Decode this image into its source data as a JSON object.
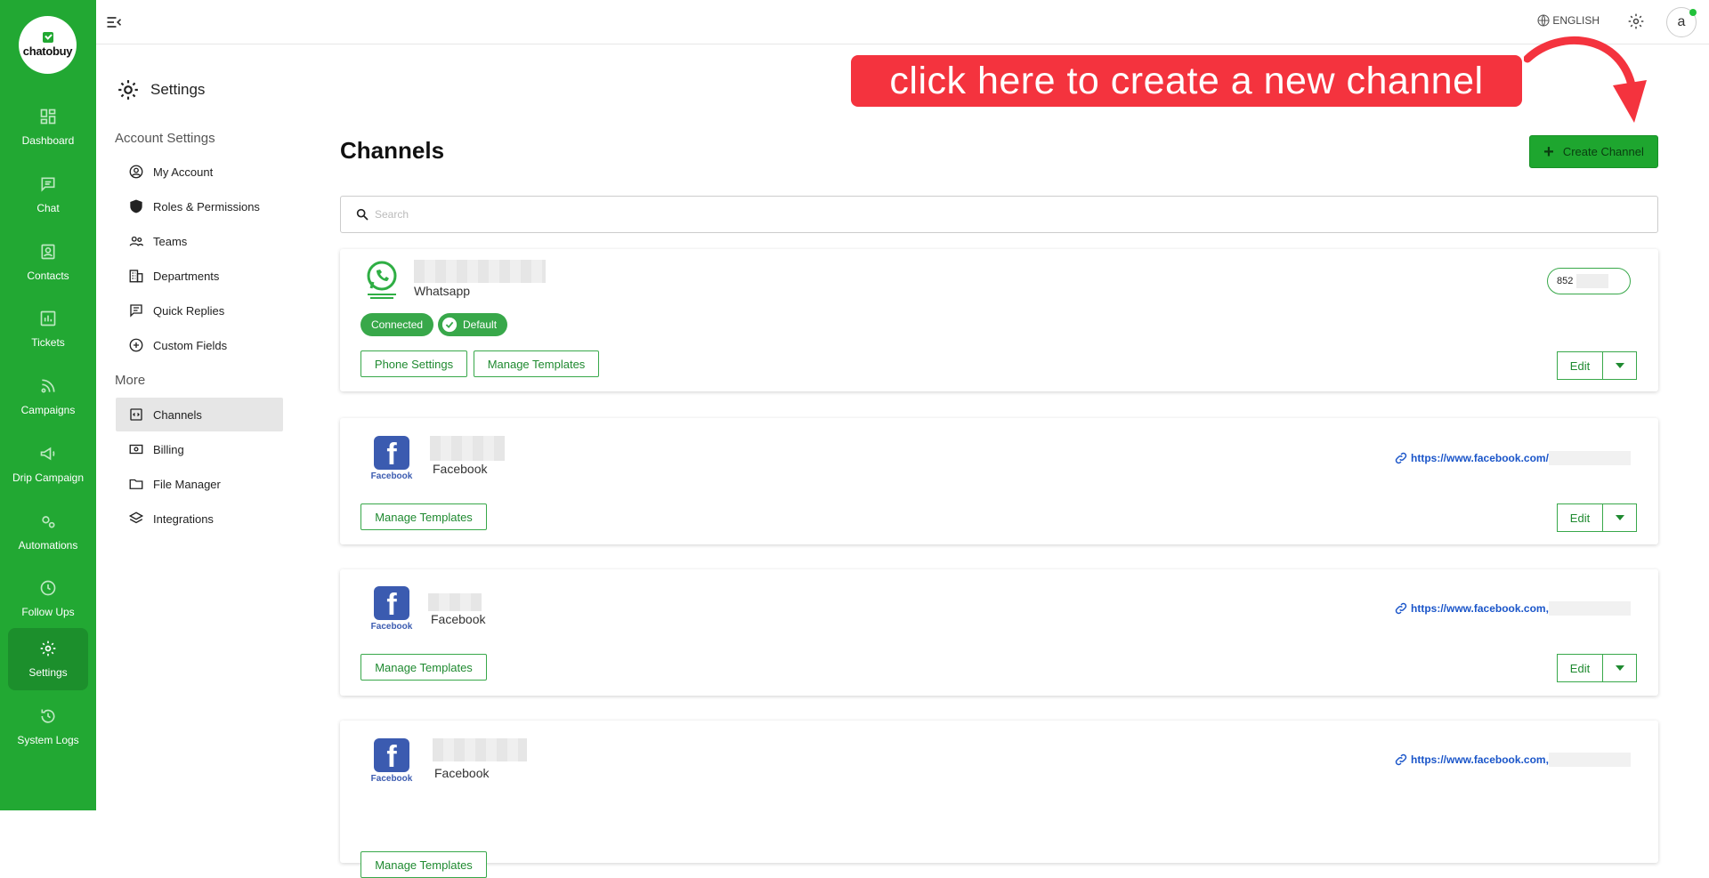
{
  "brand": {
    "logo_text": "chatobuy",
    "accent": "#22a833"
  },
  "leftnav": {
    "items": [
      {
        "label": "Dashboard",
        "icon": "dashboard-icon"
      },
      {
        "label": "Chat",
        "icon": "chat-icon"
      },
      {
        "label": "Contacts",
        "icon": "contacts-icon"
      },
      {
        "label": "Tickets",
        "icon": "tickets-icon"
      },
      {
        "label": "Campaigns",
        "icon": "rss-icon"
      },
      {
        "label": "Drip Campaign",
        "icon": "megaphone-icon"
      },
      {
        "label": "Automations",
        "icon": "cogs-icon"
      },
      {
        "label": "Follow Ups",
        "icon": "clock-icon"
      },
      {
        "label": "Settings",
        "icon": "gear-icon"
      },
      {
        "label": "System Logs",
        "icon": "history-icon"
      }
    ],
    "active": "Settings"
  },
  "topbar": {
    "language": "ENGLISH",
    "avatar_letter": "a"
  },
  "settings_sidebar": {
    "title": "Settings",
    "account_section": "Account Settings",
    "account_items": [
      {
        "label": "My Account",
        "icon": "user-circle-icon"
      },
      {
        "label": "Roles & Permissions",
        "icon": "shield-icon"
      },
      {
        "label": "Teams",
        "icon": "people-icon"
      },
      {
        "label": "Departments",
        "icon": "building-icon"
      },
      {
        "label": "Quick Replies",
        "icon": "message-icon"
      },
      {
        "label": "Custom Fields",
        "icon": "plus-circle-icon"
      }
    ],
    "more_section": "More",
    "more_items": [
      {
        "label": "Channels",
        "icon": "channels-icon"
      },
      {
        "label": "Billing",
        "icon": "billing-icon"
      },
      {
        "label": "File Manager",
        "icon": "folder-icon"
      },
      {
        "label": "Integrations",
        "icon": "layers-icon"
      }
    ]
  },
  "main": {
    "title": "Channels",
    "create_label": "Create Channel",
    "search_placeholder": "Search",
    "annotation": "click here to create a new channel"
  },
  "channels": [
    {
      "type": "Whatsapp",
      "phone": "852",
      "status": "Connected",
      "default": "Default",
      "buttons": [
        "Phone Settings",
        "Manage Templates"
      ],
      "edit": "Edit"
    },
    {
      "type": "Facebook",
      "link": "https://www.facebook.com/",
      "buttons": [
        "Manage Templates"
      ],
      "edit": "Edit",
      "logo_text": "Facebook"
    },
    {
      "type": "Facebook",
      "link": "https://www.facebook.com,",
      "buttons": [
        "Manage Templates"
      ],
      "edit": "Edit",
      "logo_text": "Facebook"
    },
    {
      "type": "Facebook",
      "link": "https://www.facebook.com,",
      "buttons": [
        "Manage Templates"
      ],
      "edit": "Edit",
      "logo_text": "Facebook"
    }
  ]
}
